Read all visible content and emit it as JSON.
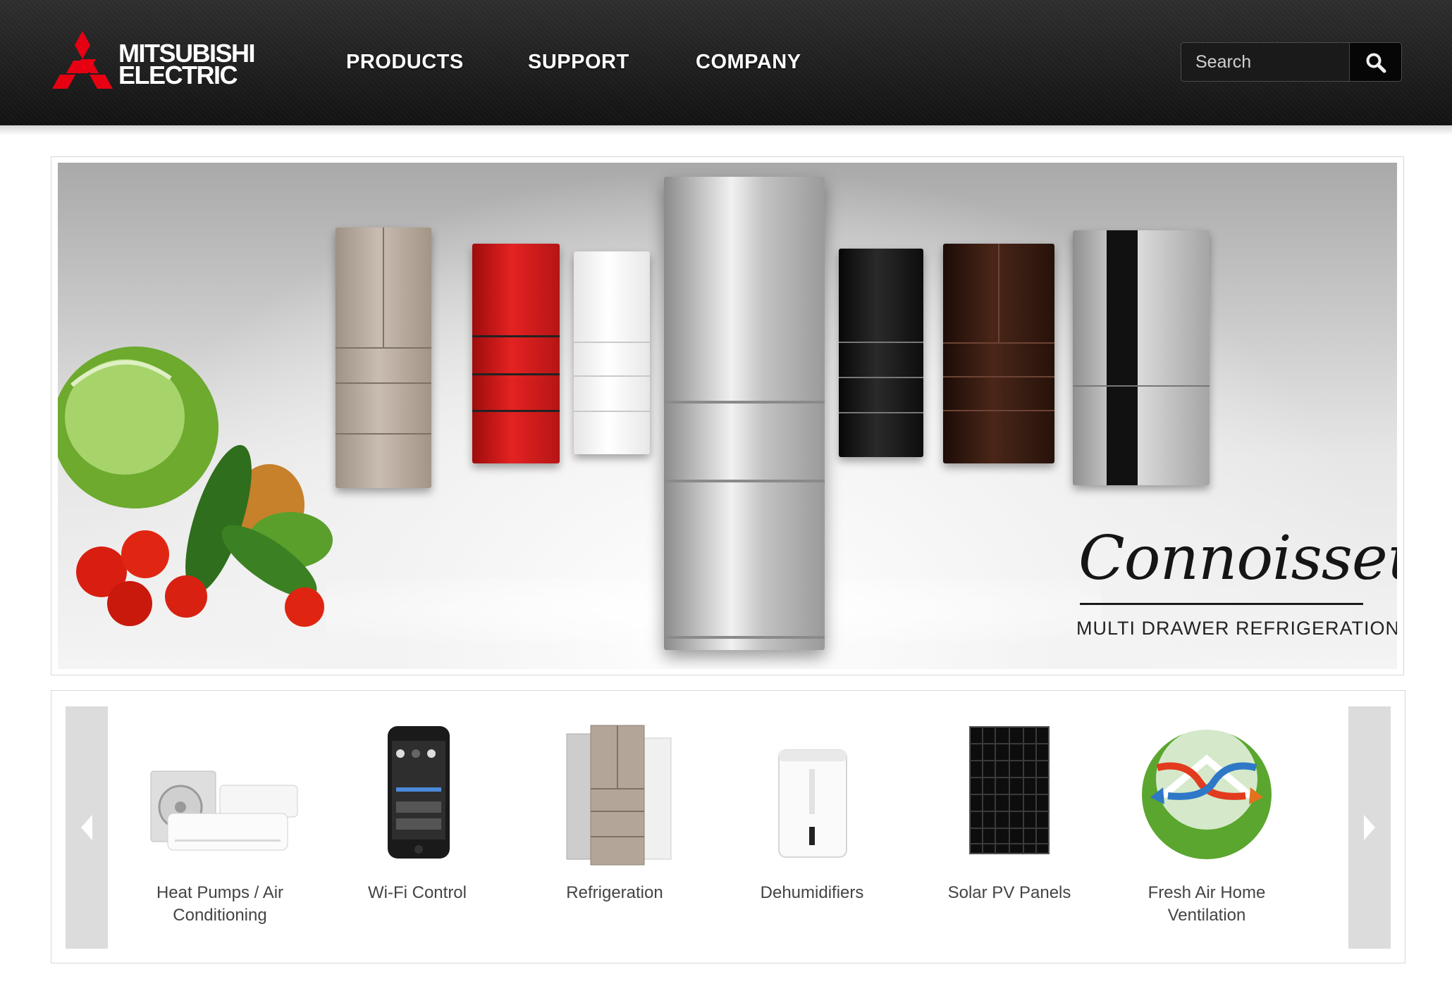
{
  "header": {
    "logo": {
      "line1": "MITSUBISHI",
      "line2": "ELECTRIC",
      "mark_color": "#e60012"
    },
    "nav": [
      {
        "label": "PRODUCTS"
      },
      {
        "label": "SUPPORT"
      },
      {
        "label": "COMPANY"
      }
    ],
    "search": {
      "placeholder": "Search",
      "icon": "search-icon"
    }
  },
  "hero": {
    "title": "Connoisseur",
    "subtitle": "MULTI DRAWER REFRIGERATION",
    "fridge_colors": [
      "champagne",
      "red",
      "white",
      "silver",
      "black",
      "brown",
      "stainless"
    ]
  },
  "carousel": {
    "prev_icon": "chevron-left-icon",
    "next_icon": "chevron-right-icon",
    "products": [
      {
        "label": "Heat Pumps / Air Conditioning",
        "icon": "heat-pump-icon"
      },
      {
        "label": "Wi-Fi Control",
        "icon": "smartphone-icon"
      },
      {
        "label": "Refrigeration",
        "icon": "fridge-icon"
      },
      {
        "label": "Dehumidifiers",
        "icon": "dehumidifier-icon"
      },
      {
        "label": "Solar PV Panels",
        "icon": "solar-panel-icon"
      },
      {
        "label": "Fresh Air Home Ventilation",
        "icon": "ventilation-icon"
      }
    ]
  }
}
